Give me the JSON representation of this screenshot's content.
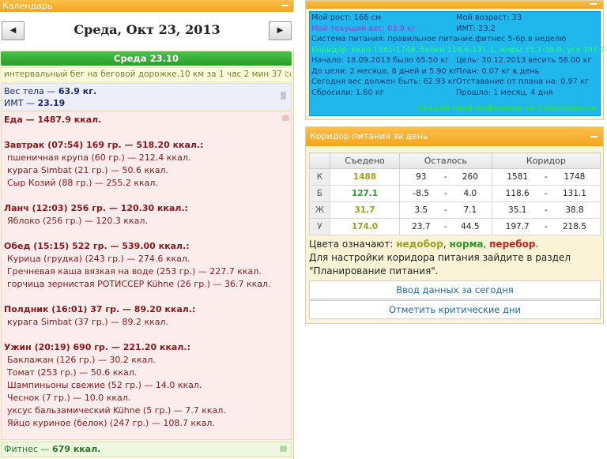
{
  "calendar": {
    "header": "Календарь",
    "date": "Среда, Окт 23, 2013",
    "prev_icon": "◀",
    "next_icon": "▶",
    "day_label": "Среда 23.10",
    "note": "интервальный бег на беговой дорожке,10 км за 1 час 2 мин 37 сек",
    "note_icon": "!",
    "weight": {
      "label": "Вес тела",
      "value": "63.9 кг."
    },
    "bmi": {
      "label": "ИМТ",
      "value": "23.19"
    },
    "food_lines": [
      {
        "kind": "head",
        "text": "Еда — 1487.9 ккал."
      },
      {
        "kind": "gap",
        "text": ""
      },
      {
        "kind": "head",
        "text": "Завтрак (07:54) 169 гр. — 518.20 ккал.:"
      },
      {
        "kind": "item",
        "text": "пшеничная крупа (60 гр.) — 212.4 ккал."
      },
      {
        "kind": "item",
        "text": "курага Simbat (21 гр.) — 50.6 ккал."
      },
      {
        "kind": "item",
        "text": "Сыр Козий (88 гр.) — 255.2 ккал."
      },
      {
        "kind": "gap",
        "text": ""
      },
      {
        "kind": "head",
        "text": "Ланч (12:03) 256 гр. — 120.30 ккал.:"
      },
      {
        "kind": "item",
        "text": "Яблоко (256 гр.) — 120.3 ккал."
      },
      {
        "kind": "gap",
        "text": ""
      },
      {
        "kind": "head",
        "text": "Обед (15:15) 522 гр. — 539.00 ккал.:"
      },
      {
        "kind": "item",
        "text": "Курица (грудка) (243 гр.) — 274.6 ккал."
      },
      {
        "kind": "item",
        "text": "Гречневая каша вязкая на воде (253 гр.) — 227.7 ккал."
      },
      {
        "kind": "item",
        "text": "горчица зернистая РОТИССЕР Kühne (26 гр.) — 36.7 ккал."
      },
      {
        "kind": "gap",
        "text": ""
      },
      {
        "kind": "head",
        "text": "Полдник (16:01) 37 гр. — 89.20 ккал.:"
      },
      {
        "kind": "item",
        "text": "курага Simbat (37 гр.) — 89.2 ккал."
      },
      {
        "kind": "gap",
        "text": ""
      },
      {
        "kind": "head",
        "text": "Ужин (20:19) 690 гр. — 221.20 ккал.:"
      },
      {
        "kind": "item",
        "text": "Баклажан (126 гр.) — 30.2 ккал."
      },
      {
        "kind": "item",
        "text": "Томат (253 гр.) — 50.6 ккал."
      },
      {
        "kind": "item",
        "text": "Шампиньоны свежие (52 гр.) — 14.0 ккал."
      },
      {
        "kind": "item",
        "text": "Чеснок (7 гр.) — 10.0 ккал."
      },
      {
        "kind": "item",
        "text": "уксус бальзамический Kühne (5 гр.) — 7.7 ккал."
      },
      {
        "kind": "item",
        "text": "Яйцо куриное (белок) (247 гр.) — 108.7 ккал."
      }
    ],
    "fitness": {
      "label": "Фитнес",
      "value": "679 ккал."
    }
  },
  "info": {
    "rows": [
      {
        "left": "Мой рост: 166 см",
        "right": "Мой возраст: 33",
        "left_style": "",
        "right_style": ""
      },
      {
        "left": "Мой текущий вес: 63.9 кг",
        "right": "ИМТ: 23.2",
        "left_style": "purple",
        "right_style": ""
      },
      {
        "left": "Система питания: правильное питание,фитнес 5-6р.в неделю",
        "right": "",
        "left_style": "",
        "right_style": ""
      },
      {
        "left": "Коридор: ккал 1581-1748, белки 118.6-131.1, жиры 35.1-38.8, угл 197.7-218.5",
        "right": "",
        "left_style": "green",
        "right_style": ""
      },
      {
        "left": "Начало: 18.09.2013 было 65.50 кг",
        "right": "Цель: 30.12.2013 весить 58.00 кг",
        "left_style": "",
        "right_style": ""
      },
      {
        "left": "До цели: 2 месяца, 8 дней и 5.90 кг",
        "right": "План: 0.07 кг в день",
        "left_style": "",
        "right_style": ""
      },
      {
        "left": "Сегодня вес должен быть: 62.93 кг",
        "right": "Отставание от плана на: 0.97 кг",
        "left_style": "",
        "right_style": ""
      },
      {
        "left": "Сбросили: 1.60 кг",
        "right": "Прошло: 1 месяц, 4 дня",
        "left_style": "",
        "right_style": ""
      }
    ],
    "link": "Создай свой информер на Calorizator.ru"
  },
  "corridor": {
    "header": "Коридор питания за день",
    "columns": [
      "",
      "Съедено",
      "Осталось",
      "Коридор"
    ],
    "rows": [
      {
        "label": "К",
        "eaten": "1488",
        "eaten_color": "olive",
        "left_min": "93",
        "left_max": "260",
        "cor_min": "1581",
        "cor_max": "1748"
      },
      {
        "label": "Б",
        "eaten": "127.1",
        "eaten_color": "green",
        "left_min": "-8.5",
        "left_max": "4.0",
        "cor_min": "118.6",
        "cor_max": "131.1"
      },
      {
        "label": "Ж",
        "eaten": "31.7",
        "eaten_color": "olive",
        "left_min": "3.5",
        "left_max": "7.1",
        "cor_min": "35.1",
        "cor_max": "38.8"
      },
      {
        "label": "У",
        "eaten": "174.0",
        "eaten_color": "olive",
        "left_min": "23.7",
        "left_max": "44.5",
        "cor_min": "197.7",
        "cor_max": "218.5"
      }
    ],
    "dash": "-",
    "legend_prefix": "Цвета означают: ",
    "legend_1": "недобор",
    "legend_sep": ", ",
    "legend_2": "норма",
    "legend_3": "перебор",
    "legend_end": ".",
    "hint": "Для настройки коридора питания зайдите в раздел \"Планирование питания\".",
    "btn_enter": "Ввод данных за сегодня",
    "btn_critical": "Отметить критические дни"
  },
  "colors": {
    "accent_orange": "#f4a520",
    "green_header": "#2a9d2a",
    "info_bg": "#1fb7ec"
  }
}
